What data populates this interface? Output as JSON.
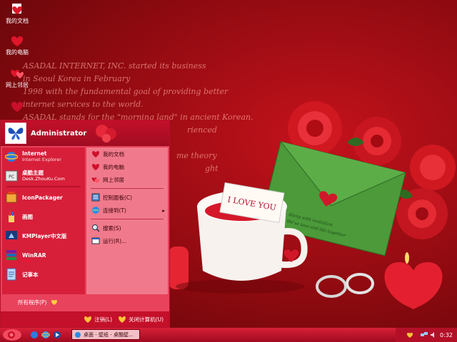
{
  "background_text": [
    "ASADAL INTERNET, INC. started its business",
    "in Seoul Korea in February",
    "1998 with the fundamental goal of providing better",
    "internet services to the world.",
    "ASADAL stands for the \"morning land\" in ancient Korean.",
    "rienced",
    "me theory",
    "ght"
  ],
  "photo": {
    "card_text": "I LOVE YOU",
    "envelope_text_line1": "Along with invitation",
    "envelope_text_line2": "We've love and life together"
  },
  "desktop": {
    "icons": [
      {
        "label": "我的文档",
        "icon": "heart-document-icon"
      },
      {
        "label": "我的电脑",
        "icon": "heart-computer-icon"
      },
      {
        "label": "网上邻居",
        "icon": "hearts-network-icon"
      },
      {
        "label": "",
        "icon": "heart-recycle-icon"
      }
    ]
  },
  "start_menu": {
    "username": "Administrator",
    "pinned": [
      {
        "title": "Internet",
        "subtitle": "Internet Explorer",
        "icon": "internet-explorer-icon"
      },
      {
        "title": "桌酷主题",
        "subtitle": "Desk.ZhouKu.Com",
        "icon": "zhouku-theme-icon"
      }
    ],
    "recent": [
      {
        "title": "IconPackager",
        "icon": "iconpackager-icon"
      },
      {
        "title": "画图",
        "icon": "paint-icon"
      },
      {
        "title": "KMPlayer中文版",
        "icon": "kmplayer-icon"
      },
      {
        "title": "WinRAR",
        "icon": "winrar-icon"
      },
      {
        "title": "记事本",
        "icon": "notepad-icon"
      }
    ],
    "all_programs": "所有程序(P)",
    "right": [
      {
        "label": "我的文档",
        "icon": "heart-document-icon"
      },
      {
        "label": "我的电脑",
        "icon": "heart-computer-icon"
      },
      {
        "label": "网上邻居",
        "icon": "hearts-network-icon"
      },
      {
        "label": "控制面板(C)",
        "icon": "control-panel-icon"
      },
      {
        "label": "连接到(T)",
        "icon": "connect-to-icon",
        "arrow": "▸"
      },
      {
        "label": "搜索(S)",
        "icon": "search-icon"
      },
      {
        "label": "运行(R)...",
        "icon": "run-icon"
      }
    ],
    "logoff": "注销(L)",
    "shutdown": "关闭计算机(U)"
  },
  "taskbar": {
    "task_label": "桌面 - 壁纸 - 桌酷壁...",
    "clock": "0:32"
  },
  "colors": {
    "accent": "#c4102a",
    "menu_left": "#d71f3a",
    "menu_right": "#f07a8c"
  }
}
